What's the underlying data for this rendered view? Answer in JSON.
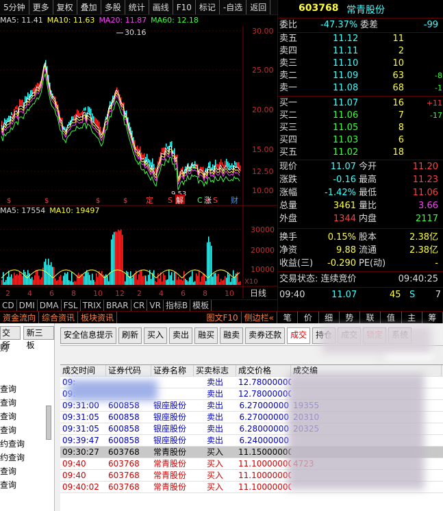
{
  "toolbar": [
    "5分钟",
    "更多",
    "复权",
    "叠加",
    "多股",
    "统计",
    "画线",
    "F10",
    "标记",
    "-自选",
    "返回"
  ],
  "ma": {
    "ma5": "MA5: 11.41",
    "ma10": "MA10: 11.63",
    "ma20": "MA20: 11.87",
    "ma60": "MA60: 12.18"
  },
  "price_axis": [
    "30.00",
    "25.00",
    "20.00",
    "15.00",
    "12.50",
    "10.00"
  ],
  "annot": {
    "high": "30.16",
    "low": "9.53"
  },
  "flags": [
    "定",
    "S",
    "解",
    "C",
    "涨",
    "S",
    "财"
  ],
  "vol_labels": {
    "ma5": "MA5: 17554",
    "ma10": "MA10: 19497",
    "unit": "X10"
  },
  "vol_axis": [
    "30000",
    "20000",
    "10000"
  ],
  "idxbar": [
    "CD",
    "DMI",
    "DMA",
    "FSL",
    "TRIX",
    "BRAR",
    "CR",
    "VR",
    "指标B",
    "模板"
  ],
  "tabbar": [
    "资金流向",
    "综合资讯",
    "板块资讯",
    "图文F10",
    "侧边栏«"
  ],
  "stock": {
    "code": "603768",
    "name": "常青股份"
  },
  "wei": {
    "label1": "委比",
    "val1": "-47.37%",
    "label2": "委差",
    "val2": "-99"
  },
  "asks": [
    {
      "l": "卖五",
      "p": "11.12",
      "v": "11",
      "d": ""
    },
    {
      "l": "卖四",
      "p": "11.11",
      "v": "2",
      "d": ""
    },
    {
      "l": "卖三",
      "p": "11.10",
      "v": "10",
      "d": ""
    },
    {
      "l": "卖二",
      "p": "11.09",
      "v": "63",
      "d": "-8"
    },
    {
      "l": "卖一",
      "p": "11.08",
      "v": "68",
      "d": "-1"
    }
  ],
  "bids": [
    {
      "l": "买一",
      "p": "11.07",
      "v": "16",
      "d": "+11"
    },
    {
      "l": "买二",
      "p": "11.06",
      "v": "7",
      "d": "-17"
    },
    {
      "l": "买三",
      "p": "11.05",
      "v": "8",
      "d": ""
    },
    {
      "l": "买四",
      "p": "11.03",
      "v": "6",
      "d": ""
    },
    {
      "l": "买五",
      "p": "11.02",
      "v": "18",
      "d": ""
    }
  ],
  "stats": [
    {
      "l1": "现价",
      "v1": "11.07",
      "l2": "今开",
      "v2": "11.20"
    },
    {
      "l1": "涨跌",
      "v1": "-0.16",
      "l2": "最高",
      "v2": "11.23"
    },
    {
      "l1": "涨幅",
      "v1": "-1.42%",
      "l2": "最低",
      "v2": "11.06"
    },
    {
      "l1": "总量",
      "v1": "3461",
      "l2": "量比",
      "v2": "3.66"
    },
    {
      "l1": "外盘",
      "v1": "1344",
      "l2": "内盘",
      "v2": "2117"
    }
  ],
  "stats2": [
    {
      "l1": "换手",
      "v1": "0.15%",
      "l2": "股本",
      "v2": "2.38亿"
    },
    {
      "l1": "净资",
      "v1": "9.88",
      "l2": "流通",
      "v2": "2.38亿"
    },
    {
      "l1": "收益(三)",
      "v1": "-0.290",
      "l2": "PE(动)",
      "v2": "-"
    }
  ],
  "status": {
    "label": "交易状态: 连续竞价",
    "time": "09:40:25"
  },
  "tick": {
    "time": "09:40",
    "price": "11.07",
    "vol": "45",
    "flag": "S",
    "n": "7"
  },
  "rtabs": [
    "笔",
    "价",
    "细",
    "势",
    "联",
    "值",
    "主",
    "筹"
  ],
  "leftnav": [
    "交所",
    "购",
    "查询",
    "查询",
    "查询",
    "查询",
    "约查询",
    "约查询",
    "查询",
    "查询"
  ],
  "leftnav_tab": "新三板",
  "buttons": [
    "安全信息提示",
    "刷新",
    "买入",
    "卖出",
    "融买",
    "融卖",
    "卖券还款",
    "成交",
    "持仓",
    "成交",
    "锁定",
    "系统"
  ],
  "table": {
    "headers": [
      "成交时间",
      "证券代码",
      "证券名称",
      "买卖标志",
      "成交价格",
      "成交编"
    ],
    "rows": [
      {
        "t": "09:",
        "c": "",
        "n": "",
        "f": "卖出",
        "p": "12.78000000",
        "id": "",
        "color": "blue"
      },
      {
        "t": "09:",
        "c": "",
        "n": "",
        "f": "卖出",
        "p": "12.78000000",
        "id": "",
        "color": "blue"
      },
      {
        "t": "09:31:00",
        "c": "600858",
        "n": "银座股份",
        "f": "卖出",
        "p": "6.27000000",
        "id": "19355",
        "color": "blue"
      },
      {
        "t": "09:31:05",
        "c": "600858",
        "n": "银座股份",
        "f": "卖出",
        "p": "6.27000000",
        "id": "20310",
        "color": "blue"
      },
      {
        "t": "09:31:05",
        "c": "600858",
        "n": "银座股份",
        "f": "卖出",
        "p": "6.28000000",
        "id": "20325",
        "color": "blue"
      },
      {
        "t": "09:39:47",
        "c": "600858",
        "n": "银座股份",
        "f": "卖出",
        "p": "6.24000000",
        "id": "",
        "color": "blue"
      },
      {
        "t": "09:30:27",
        "c": "603768",
        "n": "常青股份",
        "f": "买入",
        "p": "11.15000000",
        "id": "",
        "color": "black"
      },
      {
        "t": "09:40",
        "c": "603768",
        "n": "常青股份",
        "f": "买入",
        "p": "11.10000000",
        "id": "4723",
        "color": "red"
      },
      {
        "t": "09:40",
        "c": "603768",
        "n": "常青股份",
        "f": "买入",
        "p": "11.10000000",
        "id": "",
        "color": "red"
      },
      {
        "t": "09:40:02",
        "c": "603768",
        "n": "常青股份",
        "f": "买入",
        "p": "11.10000000",
        "id": "",
        "color": "red"
      }
    ]
  }
}
